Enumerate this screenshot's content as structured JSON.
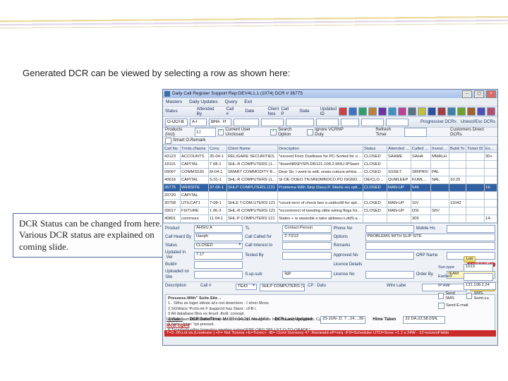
{
  "intro": "Generated DCR can be viewed by selecting a row as shown here:",
  "callout": "DCR Status can be changed from here. Various DCR status are explained on coming slide.",
  "window": {
    "title": "Daily Call Register  Support Rep:DEV4L1.1 (1074)  DCR # 36775",
    "menu": [
      "Masters",
      "Daily Updates",
      "Query",
      "Exit"
    ]
  },
  "toolbar1": {
    "status_lbl": "Status",
    "status_1": "O-OOTB",
    "status_2": "A-I",
    "status_3": "BHA   H",
    "attended_lbl": "Attended By",
    "callno_lbl": "Call #",
    "date_lbl": "Date",
    "client_lbl": "Client Nos",
    "callp_lbl": "Call P",
    "state_lbl": "State",
    "upd_lbl": "Updated ID",
    "right_lbls": {
      "prog": "Progressive DCRs",
      "unesc": "Unescl/Esc DCRs"
    }
  },
  "toolbar2": {
    "prod_lbl": "Products (Incl)",
    "prod_val": "(.)",
    "cb1": "Current User Unclosed",
    "cb2": "Search Option",
    "cb3": "Ignore VCRNP Duty",
    "rb1": "Smart O.Remark",
    "rc1": "Refresh Timer",
    "rc2": "Customers Direct DCRs"
  },
  "grid": {
    "headers": [
      "Call No",
      "Trnds.cName",
      "Cons",
      "Client Name",
      "Description",
      "Status",
      "Attended By",
      "Called For",
      "Investor No",
      "Build To",
      "Ticket ID",
      "Escl Own"
    ],
    "rows": [
      [
        "43123",
        "ACCOUNTS",
        "35-04-1",
        "RELIGARE SECURITIES",
        "*exceed Frien Dustbass for PC-Sorted for onbosses",
        "CLOSED",
        "SAAME",
        "SAHA",
        "MMALH",
        "",
        "",
        "30+"
      ],
      [
        "18116",
        "CAPITAL",
        "T 08-1",
        "SHL-R COMPUTERS (131",
        "*downNBSP/SPLDR121.108.2.MXU.IPSwet:",
        "CLOSED",
        "",
        "",
        "",
        "",
        "",
        ""
      ],
      [
        "09097",
        "COMMS530",
        "M-04-1",
        "SMART COMMODITY BRC",
        "Dear Sir, I went to wdL onatu-cukura whina wva",
        "CLOSED",
        "SSSET",
        "SRIPRIV",
        "PAL",
        "",
        "",
        ""
      ],
      [
        "40616",
        "CAPITAL",
        "S.01-1",
        "SHL-R COMPUTERS (131",
        "SI OE OOEO TN.MNOMNOCO.PO ISGNOfore",
        "OE/CLOSED",
        "QUMLEEP",
        "KUMLEEP",
        "NAL",
        "10.25",
        "",
        ""
      ],
      [
        "36775",
        "WEBSITE",
        "37-06-1",
        "SHLP COMPUTERS (131",
        "Problema With Strip Discu.P. Stiehs rec rptt una",
        "CLOSED",
        "MAN-UP",
        "545",
        "",
        "",
        "",
        "16-"
      ],
      [
        "20720",
        "CAPITAL",
        "",
        "",
        "",
        "",
        "",
        "",
        "",
        "",
        "",
        ""
      ],
      [
        "30758",
        "UTILCAT1",
        "7-08-1",
        "SHLE T.COM.UTERS:121",
        "*count-rerct of chock bes e.usblcoM for split.blp",
        "CLOSED",
        "MAN-UP",
        "S/V",
        "",
        "11042",
        "",
        ""
      ],
      [
        "39017",
        "FIXTURE",
        "1 06-3",
        "SHL-R COMPUTERS:121",
        "*ecoxmrerct of teesting vible wiring flogs for the:ip",
        "CLOSED",
        "MAN-UP",
        "DSI",
        "S6V",
        "",
        "",
        ""
      ],
      [
        "40801",
        "commsso",
        "11.04-1",
        "SHL:P COMPUTERS:121",
        "States + w wwwobk-x.taire abbwss.n.ddS-amtd.doSw",
        "",
        "",
        "305",
        "",
        "",
        "",
        "14-"
      ]
    ]
  },
  "detail": {
    "product_lbl": "Product",
    "product_val": "AHSIU A",
    "tl_lbl": "TL",
    "tl_val": "Contact Person",
    "phone_lbl": "Phone No",
    "mobile_lbl": "Mobile Ho",
    "callhead_lbl": "Call Heard By",
    "callhead_val": "Haoph",
    "callfor_lbl": "Call Called for",
    "callfor_val": "2·7/213",
    "options_lbl": "Options",
    "options_val": "PROBLEMS WITH SLIP SITE",
    "callint_lbl": "Call Interest to",
    "remarks_lbl": "Remarks",
    "status_lbl": "Status",
    "status_val": "CLOSED",
    "approved_lbl": "Approved No",
    "orp_lbl": "ORP Name",
    "updin_lbl": "Updated in .Ver",
    "updin_val": "7.17",
    "tested_lbl": "Tested By",
    "license_lbl": "Licence Details",
    "buildno_lbl": "Build#",
    "red_badge": "Leadup offLe",
    "uploaded_lbl": "Uploaded on Site",
    "supsub_lbl": "S.up.sub:",
    "supsub_val": "Iigh",
    "licenseno_lbl": "License No",
    "orderby_lbl": "Order By",
    "orderby_val": "IEAM",
    "direct_lbl": "Direc-t",
    "earlier_lbl": "Earlier#"
  },
  "desc": {
    "desc_lbl": "Description",
    "call_lbl": "Call # ",
    "ticket_sel": "TE43",
    "client": "SHLP COMPUTERS (131.388.2.1)",
    "cp_tag": "CP : Datu",
    "wire_lbl": "Wire Labe",
    "trace_btn": "Trace(F11)",
    "suntype_lbl": "Sun,type",
    "suntype_val": "1013"
  },
  "presswat": {
    "title": "Pressess.With\" Suite.Site ..",
    "lines": [
      "1 . Siths as biget stitute at's not downIsos  - I shon Moos",
      "2.SGWans 'Prcbi.mt F &appcrd has Stant : cFB i.",
      "3 All database files es linuol -lhotl. corespl.",
      "4 Wate awn daud scllconl rob-shl finonle.it an.rewage-dis hitpr on-respond gyllen.  Cye DIN-Plea.)",
      "5 Note viptar: 'rpt pressol.",
      "",
      "6:Troarlashuolhig hiwesirry wpating rratas((ERF ORG:*RE LET D-TO-ORADE\""
    ]
  },
  "side_right": {
    "list_btn": "List",
    "ipadr_lbl": "IP Adlr",
    "ipadr_val": "131.108.2.24",
    "cb_sms": "Send SMS",
    "cb_sms_cust": "SMS-Somt.cu",
    "cb_email": "Send E-mail"
  },
  "updates": {
    "updated_lbl": "Updated",
    "mostugent_lbl": "Most Ugent",
    "dcrdt_lbl": "DCR Date/Time:",
    "dcrdt_val": "M.t.27 I.04.211 No.AMU",
    "lastu_lbl": "DCR.Last Updated:",
    "lastu_v1": "23-JUN-.D. 7...24....39",
    "time_lbl": "Hime Taken",
    "time_val": "22 DA.22.58.0SN."
  },
  "bottom_bar": "T=3 .00.Lot es.(Lmokoee ) +F= Not Toxoos +E=Ticrec> -\\B= Clord Surrwory 47 :Reiriewid eP=orq -\\F9=Scheduler UTO=Sove +1 1 s.24W - 12+esvsreFields",
  "icons": [
    "#d04040",
    "#4070c0",
    "#30a060",
    "#c08030",
    "#7030a0",
    "#4090c0",
    "#c04090",
    "#607080",
    "#c0c040",
    "#3050a0",
    "#a04040",
    "#4080a0",
    "#70a030",
    "#a06030",
    "#5050b0",
    "#b05070"
  ]
}
